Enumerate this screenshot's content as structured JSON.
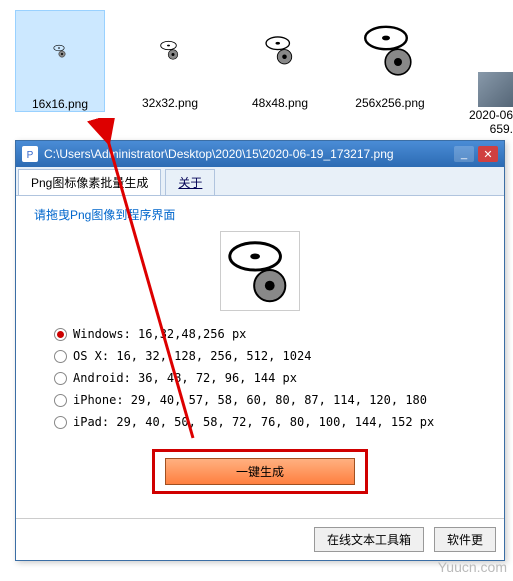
{
  "explorer": {
    "files": [
      {
        "label": "16x16.png"
      },
      {
        "label": "32x32.png"
      },
      {
        "label": "48x48.png"
      },
      {
        "label": "256x256.png"
      }
    ],
    "extraFile": {
      "label": "2020-06\n659."
    }
  },
  "dialog": {
    "title": "C:\\Users\\Administrator\\Desktop\\2020\\15\\2020-06-19_173217.png",
    "tabs": {
      "main": "Png图标像素批量生成",
      "about": "关于"
    },
    "hint": "请拖曳Png图像到程序界面",
    "options": [
      {
        "label": "Windows: 16,32,48,256 px",
        "checked": true
      },
      {
        "label": "OS X: 16, 32, 128, 256, 512, 1024",
        "checked": false
      },
      {
        "label": "Android: 36, 48, 72, 96, 144 px",
        "checked": false
      },
      {
        "label": "iPhone: 29, 40, 57, 58, 60, 80, 87, 114, 120, 180",
        "checked": false
      },
      {
        "label": "iPad: 29, 40, 50, 58, 72, 76, 80, 100, 144, 152 px",
        "checked": false
      }
    ],
    "generate_btn": "一键生成",
    "bottom_btn1": "在线文本工具箱",
    "bottom_btn2": "软件更"
  },
  "watermark": "Yuucn.com"
}
